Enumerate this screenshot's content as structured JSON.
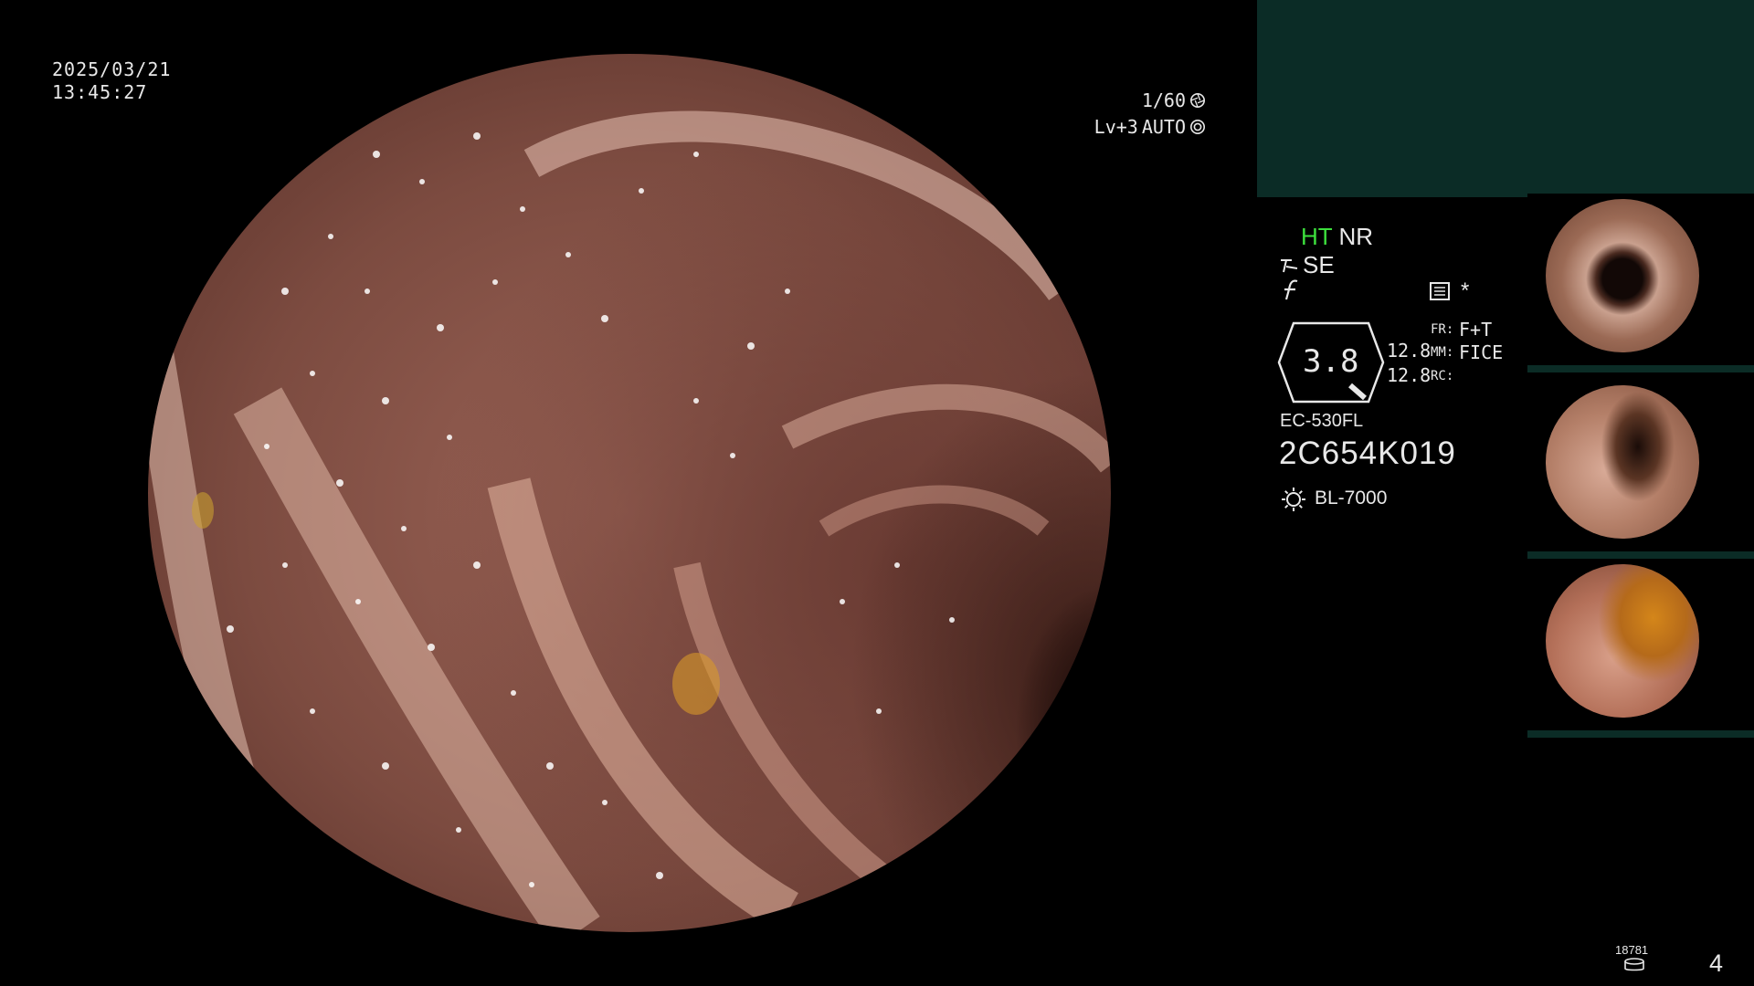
{
  "timestamp": {
    "date": "2025/03/21",
    "time": "13:45:27"
  },
  "exposure": {
    "shutter": "1/60",
    "level": "Lv+3",
    "mode": "AUTO",
    "shutter_icon": "aperture-icon",
    "mode_icon": "iris-icon"
  },
  "processor": {
    "ht": "HT",
    "nr": "NR",
    "se": "SE",
    "zoom": "3.8",
    "value_1": "12.8",
    "value_2": "12.8",
    "fr_label": "FR:",
    "fr_value": "F+T",
    "mm_label": "MM:",
    "mm_value": "FICE",
    "rc_label": "RC:",
    "asterisk": "*",
    "ht_color": "#3de03d"
  },
  "scope": {
    "model": "EC-530FL",
    "serial": "2C654K019"
  },
  "light_source": {
    "label": "BL-7000",
    "icon": "light-source-icon"
  },
  "thumbnails": [
    {
      "index": 1
    },
    {
      "index": 2
    },
    {
      "index": 3
    }
  ],
  "storage": {
    "count": "18781",
    "icon": "disk-icon"
  },
  "page_number": "4",
  "colors": {
    "background": "#000000",
    "panel_teal": "#0b2c26"
  }
}
